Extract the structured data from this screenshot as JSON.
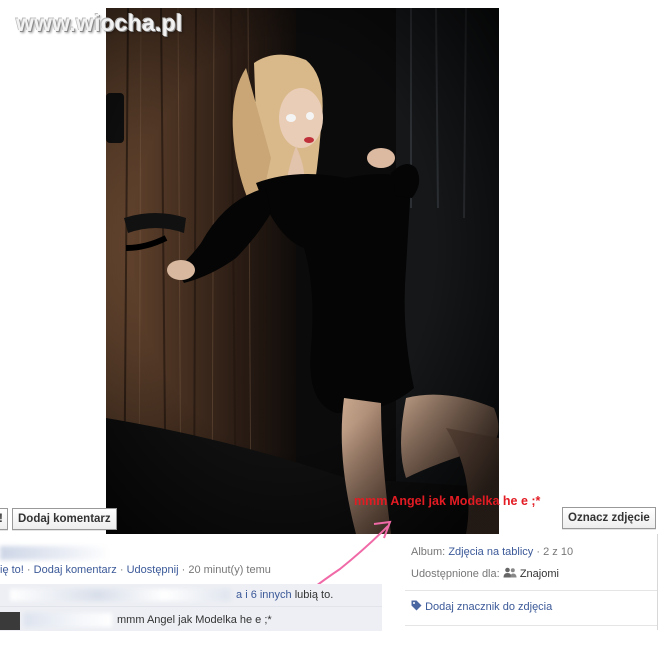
{
  "watermark": "www.wiocha.pl",
  "photo_overlay": {
    "caption": "mmm Angel jak Modelka he e ;*"
  },
  "buttons": {
    "like_fragment": "!",
    "add_comment": "Dodaj komentarz",
    "tag_photo": "Oznacz zdjęcie"
  },
  "actions": {
    "like": "ię to!",
    "sep1": " · ",
    "comment": "Dodaj komentarz",
    "sep2": " · ",
    "share": "Udostępnij",
    "sep3": " · ",
    "time": "20 minut(y) temu"
  },
  "likes": {
    "name_fragment": "a",
    "others": "i 6 innych",
    "suffix": "lubią to."
  },
  "comment": {
    "text": "mmm Angel jak Modelka he e ;*"
  },
  "meta": {
    "album_label": "Album:",
    "album_link": "Zdjęcia na tablicy",
    "album_position": "· 2 z 10",
    "shared_label": "Udostępnione dla:",
    "shared_value": "Znajomi",
    "tag_link": "Dodaj znacznik do zdjęcia"
  },
  "colors": {
    "link": "#3b5998",
    "overlay_caption": "#e31b23",
    "arrow": "#f06aa8"
  },
  "icons": [
    "friends-icon",
    "tag-icon"
  ]
}
